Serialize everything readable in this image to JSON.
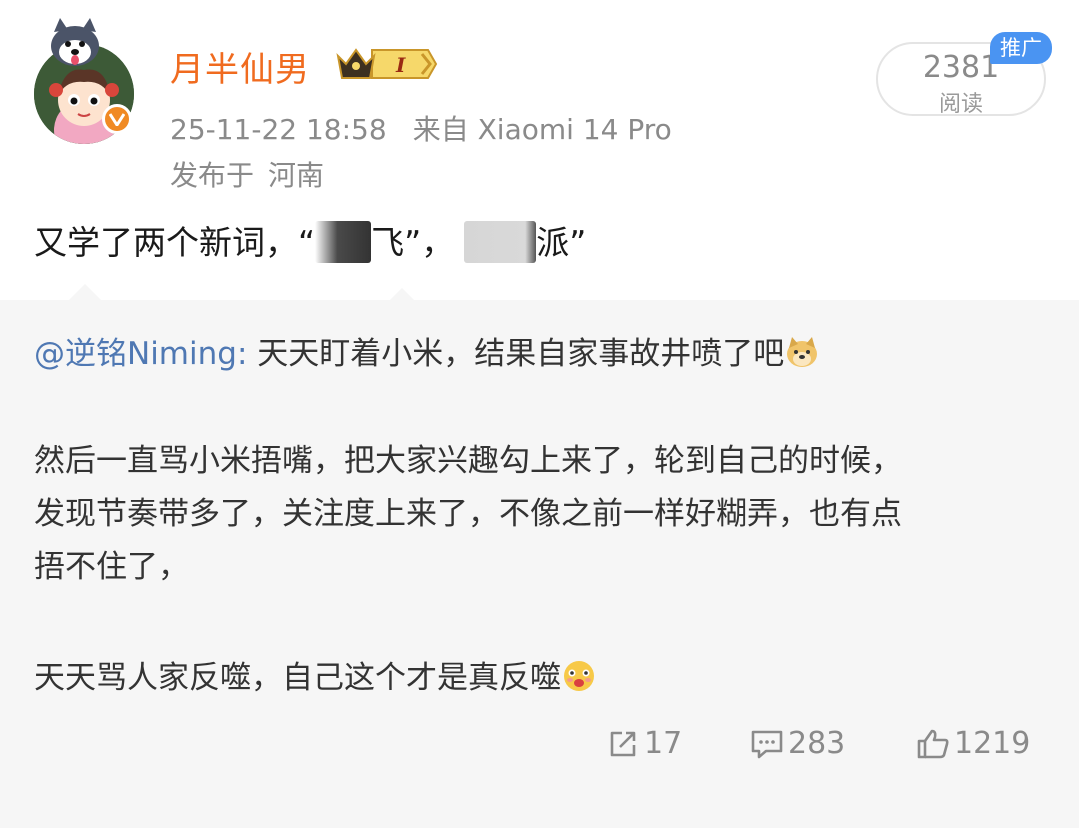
{
  "post": {
    "author_name": "月半仙男",
    "rank_badge_text": "I",
    "timestamp": "25-11-22 18:58",
    "source_prefix": "来自",
    "device": "Xiaomi 14 Pro",
    "location_prefix": "发布于",
    "location": "河南",
    "read_count": "2381",
    "read_label": "阅读",
    "promo_tag": "推广",
    "text_part1": "又学了两个新词，“",
    "text_part2": "飞”，",
    "text_part3": "派”"
  },
  "repost": {
    "mention": "@逆铭Niming:",
    "line1": " 天天盯着小米，结果自家事故井喷了吧",
    "line2a": "然后一直骂小米捂嘴，把大家兴趣勾上来了，轮到自己的时候，",
    "line2b": "发现节奏带多了，关注度上来了，不像之前一样好糊弄，也有点",
    "line2c": "捂不住了，",
    "line3": "天天骂人家反噬，自己这个才是真反噬",
    "reposts": "17",
    "comments": "283",
    "likes": "1219"
  },
  "icons": {
    "verified": "verified-v-icon",
    "crown": "crown-icon",
    "doge_emoji": "doge-emoji-icon",
    "pout_emoji": "pout-emoji-icon",
    "repost": "repost-icon",
    "comment": "comment-icon",
    "like": "thumbs-up-icon"
  },
  "colors": {
    "author": "#f06b1f",
    "mention": "#4f78b3",
    "promo": "#4a94f2",
    "repost_bg": "#f6f6f6"
  }
}
